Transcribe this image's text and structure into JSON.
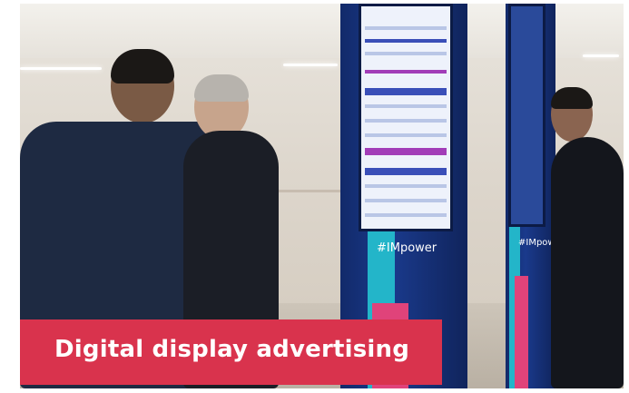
{
  "banner": {
    "text": "Digital display advertising"
  },
  "totem_left": {
    "hashtag": "#IMpower"
  },
  "totem_right": {
    "hashtag": "#IMpower"
  },
  "colors": {
    "banner": "#d9334d",
    "totem": "#1a3a8c",
    "suit": "#1e2a42"
  }
}
